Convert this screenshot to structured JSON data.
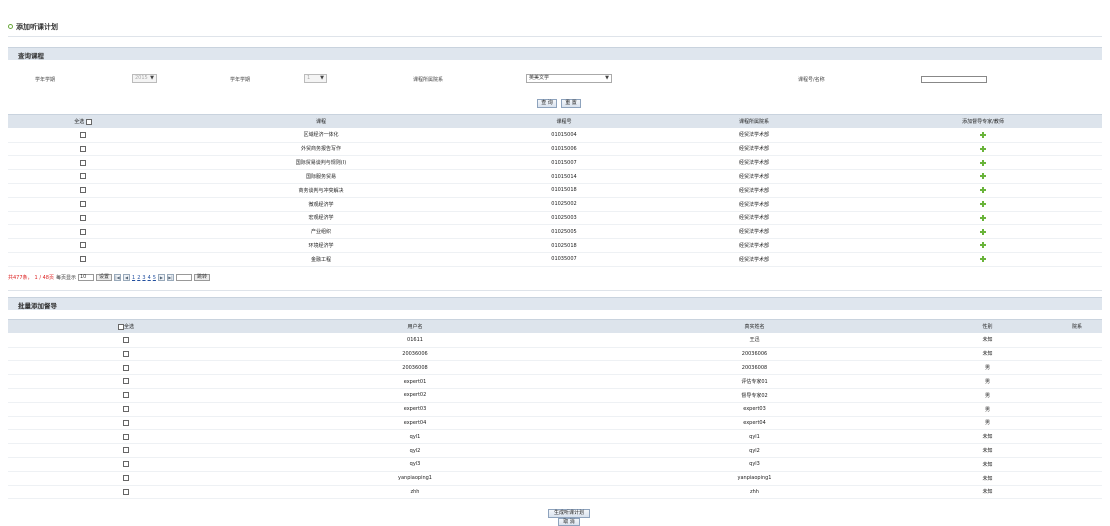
{
  "page": {
    "title": "添加听课计划"
  },
  "search": {
    "section_title": "查询课程",
    "labels": {
      "year": "学年学期",
      "term": "学年学期",
      "college": "课程所属院系",
      "course": "课程号/名称"
    },
    "year_value": "2015",
    "term_value": "1",
    "college_value": "英美文学",
    "course_value": "",
    "query_button": "查 询",
    "reset_button": "重 置"
  },
  "courses": {
    "headers": {
      "select_all": "全选",
      "name": "课程",
      "code": "课程号",
      "dept": "课程所属院系",
      "action": "添加督导专家/教师"
    },
    "rows": [
      {
        "name": "区域经济一体化",
        "code": "01015004",
        "dept": "经贸法学术部"
      },
      {
        "name": "外贸商务报告写作",
        "code": "01015006",
        "dept": "经贸法学术部"
      },
      {
        "name": "国际贸易谈判与规则(I)",
        "code": "01015007",
        "dept": "经贸法学术部"
      },
      {
        "name": "国际服务贸易",
        "code": "01015014",
        "dept": "经贸法学术部"
      },
      {
        "name": "商务谈判与冲突解决",
        "code": "01015018",
        "dept": "经贸法学术部"
      },
      {
        "name": "微观经济学",
        "code": "01025002",
        "dept": "经贸法学术部"
      },
      {
        "name": "宏观经济学",
        "code": "01025003",
        "dept": "经贸法学术部"
      },
      {
        "name": "产业组织",
        "code": "01025005",
        "dept": "经贸法学术部"
      },
      {
        "name": "环境经济学",
        "code": "01025018",
        "dept": "经贸法学术部"
      },
      {
        "name": "金融工程",
        "code": "01035007",
        "dept": "经贸法学术部"
      }
    ]
  },
  "pager": {
    "summary_prefix": "共477条，",
    "page_info": "1 / 48页",
    "per_page_label": "每页显示",
    "per_page_value": "10",
    "set_button": "设置",
    "pages": [
      "1",
      "2",
      "3",
      "4",
      "5"
    ],
    "goto_button": "跳转"
  },
  "supervisors": {
    "section_title": "批量添加督导",
    "headers": {
      "select_all": "全选",
      "username": "用户名",
      "realname": "真实姓名",
      "gender": "性别",
      "dept": "院系"
    },
    "rows": [
      {
        "username": "01611",
        "realname": "王迅",
        "gender": "未知"
      },
      {
        "username": "20036006",
        "realname": "20036006",
        "gender": "未知"
      },
      {
        "username": "20036008",
        "realname": "20036008",
        "gender": "男"
      },
      {
        "username": "expert01",
        "realname": "评估专家01",
        "gender": "男"
      },
      {
        "username": "expert02",
        "realname": "督导专家02",
        "gender": "男"
      },
      {
        "username": "expert03",
        "realname": "expert03",
        "gender": "男"
      },
      {
        "username": "expert04",
        "realname": "expert04",
        "gender": "男"
      },
      {
        "username": "qyl1",
        "realname": "qyl1",
        "gender": "未知"
      },
      {
        "username": "qyl2",
        "realname": "qyl2",
        "gender": "未知"
      },
      {
        "username": "qyl3",
        "realname": "qyl3",
        "gender": "未知"
      },
      {
        "username": "yanpiaoping1",
        "realname": "yanpiaoping1",
        "gender": "未知"
      },
      {
        "username": "zhh",
        "realname": "zhh",
        "gender": "未知"
      }
    ]
  },
  "footer": {
    "generate_button": "生成听课计划",
    "cancel_button": "取 消"
  },
  "colors": {
    "accent_green": "#69b43a",
    "header_bg": "#dde4ec",
    "button_border": "#8ea3bd"
  }
}
